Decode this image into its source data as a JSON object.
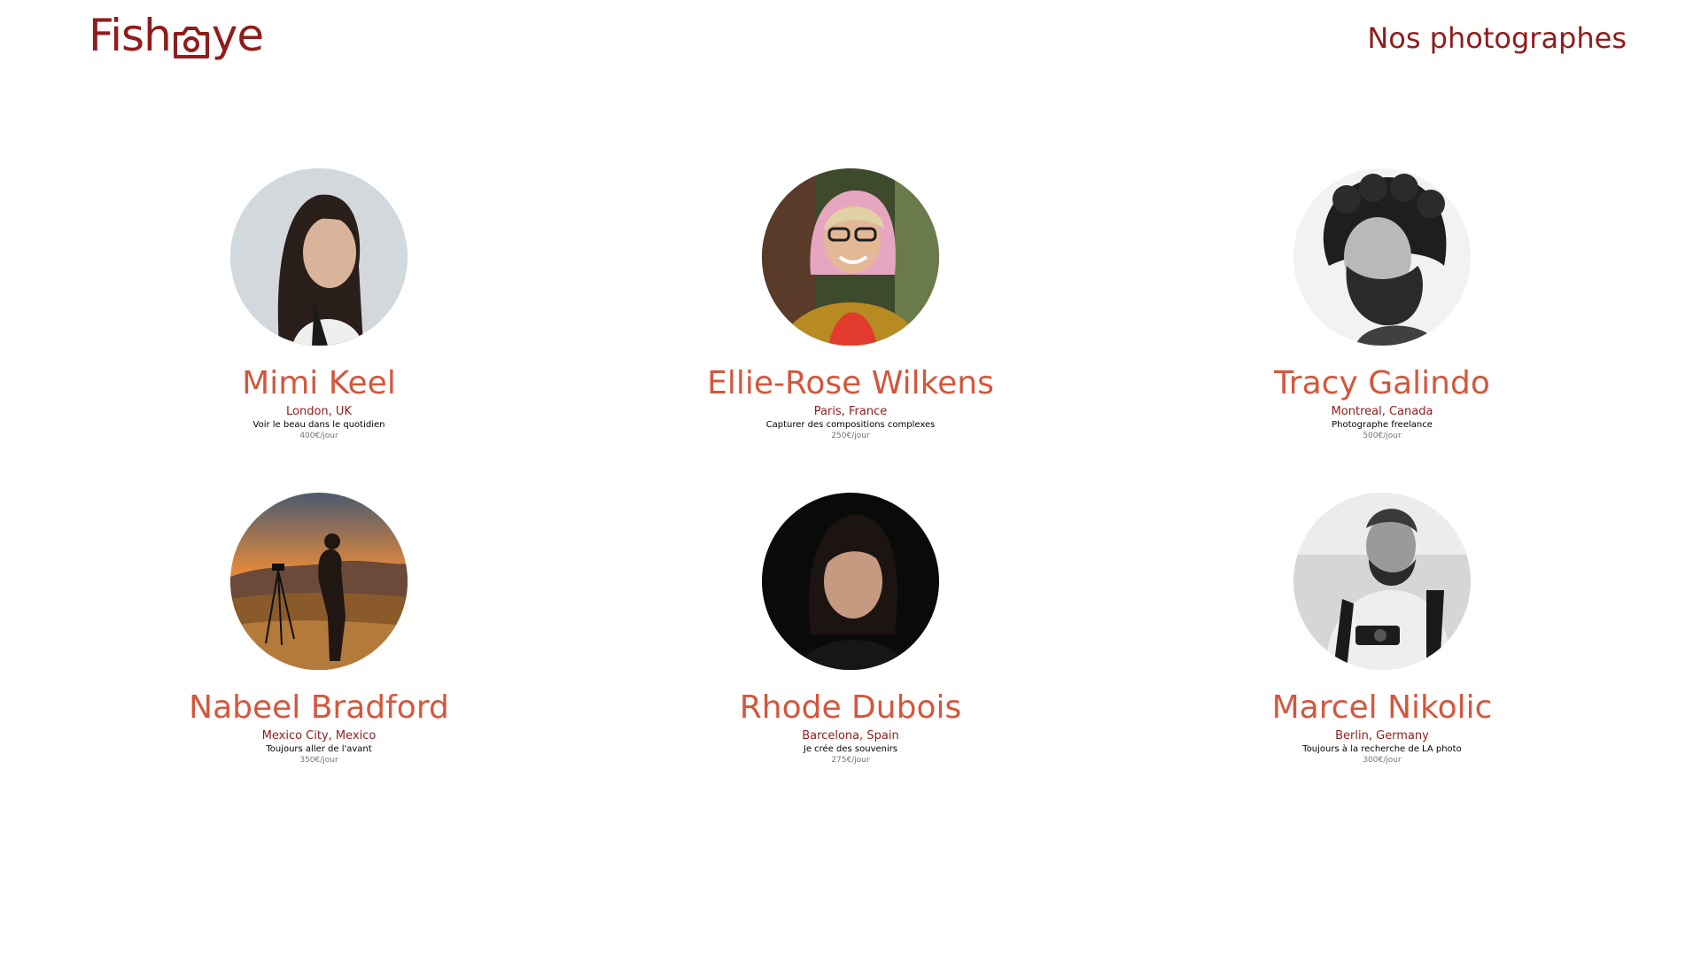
{
  "header": {
    "logo_text_left": "Fish",
    "logo_text_right": "ye",
    "logo_icon": "camera-icon",
    "title": "Nos photographes"
  },
  "colors": {
    "brand_dark": "#901C1C",
    "name_accent": "#D3573C",
    "price_gray": "#757575"
  },
  "photographers": [
    {
      "name": "Mimi Keel",
      "location": "London, UK",
      "tagline": "Voir le beau dans le quotidien",
      "price": "400€/jour"
    },
    {
      "name": "Ellie-Rose Wilkens",
      "location": "Paris, France",
      "tagline": "Capturer des compositions complexes",
      "price": "250€/jour"
    },
    {
      "name": "Tracy Galindo",
      "location": "Montreal, Canada",
      "tagline": "Photographe freelance",
      "price": "500€/jour"
    },
    {
      "name": "Nabeel Bradford",
      "location": "Mexico City, Mexico",
      "tagline": "Toujours aller de l'avant",
      "price": "350€/jour"
    },
    {
      "name": "Rhode Dubois",
      "location": "Barcelona, Spain",
      "tagline": "Je crée des souvenirs",
      "price": "275€/jour"
    },
    {
      "name": "Marcel Nikolic",
      "location": "Berlin, Germany",
      "tagline": "Toujours à la recherche de LA photo",
      "price": "300€/jour"
    }
  ]
}
